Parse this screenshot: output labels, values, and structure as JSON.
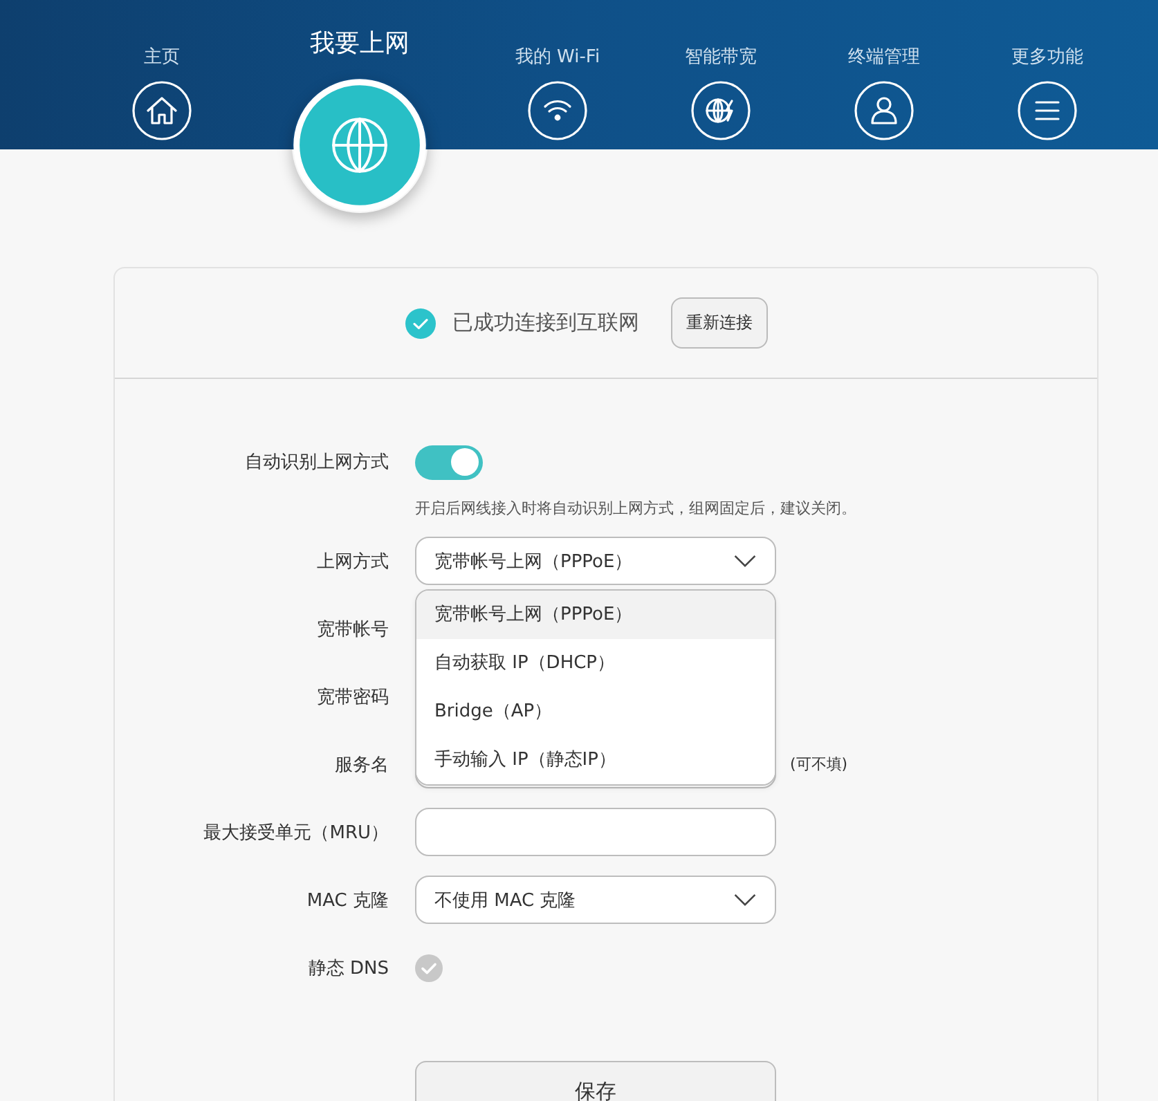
{
  "nav": [
    {
      "label": "主页",
      "selected": false
    },
    {
      "label": "我要上网",
      "selected": true
    },
    {
      "label": "我的 Wi-Fi",
      "selected": false
    },
    {
      "label": "智能带宽",
      "selected": false
    },
    {
      "label": "终端管理",
      "selected": false
    },
    {
      "label": "更多功能",
      "selected": false
    }
  ],
  "status": {
    "connected": true,
    "text": "已成功连接到互联网",
    "button": "重新连接"
  },
  "form": {
    "rows": [
      {
        "kind": "toggle",
        "label": "自动识别上网方式",
        "on": true,
        "hint": "开启后网线接入时将自动识别上网方式，组网固定后，建议关闭。"
      },
      {
        "kind": "select",
        "label": "上网方式",
        "value": "宽带帐号上网（PPPoE）",
        "open": true,
        "options": [
          {
            "label": "宽带帐号上网（PPPoE）",
            "selected": true
          },
          {
            "label": "自动获取 IP（DHCP）",
            "selected": false
          },
          {
            "label": "Bridge（AP）",
            "selected": false
          },
          {
            "label": "手动输入 IP（静态IP）",
            "selected": false
          }
        ]
      },
      {
        "kind": "input",
        "label": "宽带帐号"
      },
      {
        "kind": "input",
        "label": "宽带密码"
      },
      {
        "kind": "input",
        "label": "服务名",
        "note": "(可不填)"
      },
      {
        "kind": "input",
        "label": "最大接受单元（MRU）"
      },
      {
        "kind": "select",
        "label": "MAC 克隆",
        "value": "不使用 MAC 克隆",
        "open": false
      },
      {
        "kind": "checkbox",
        "label": "静态 DNS",
        "checked": false
      }
    ],
    "save": "保存"
  }
}
